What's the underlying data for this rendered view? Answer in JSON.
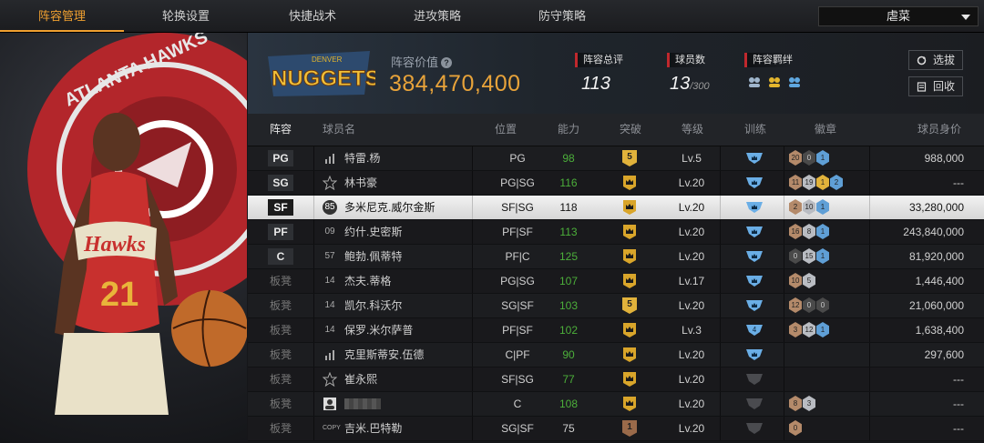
{
  "tabs": [
    {
      "label": "阵容管理",
      "active": true
    },
    {
      "label": "轮换设置",
      "active": false
    },
    {
      "label": "快捷战术",
      "active": false
    },
    {
      "label": "进攻策略",
      "active": false
    },
    {
      "label": "防守策略",
      "active": false
    }
  ],
  "difficulty": {
    "value": "虐菜"
  },
  "left_art": {
    "logo_text": "ATLANTA HAWKS",
    "jersey_text": "Hawks",
    "jersey_number": "21"
  },
  "header": {
    "team_logo_text": "NUGGETS",
    "team_logo_small": "DENVER",
    "value_label": "阵容价值",
    "value": "384,470,400",
    "rating_label": "阵容总评",
    "rating": "113",
    "players_label": "球员数",
    "players": "13",
    "players_max": "/300",
    "bond_label": "阵容羁绊",
    "select_btn": "选拔",
    "recycle_btn": "回收"
  },
  "columns": [
    "阵容",
    "球员名",
    "位置",
    "能力",
    "突破",
    "等级",
    "训练",
    "徽章",
    "球员身价"
  ],
  "colors": {
    "accent": "#f0a030",
    "value": "#e8a33a",
    "green": "#4caf3a",
    "red": "#c0282d"
  },
  "rows": [
    {
      "slot": "PG",
      "starter": true,
      "icon": "bars",
      "name": "特雷.杨",
      "pos": "PG",
      "ovr": "98",
      "green": true,
      "breakthrough": "5",
      "bk_type": "gold-num",
      "level": "Lv.5",
      "train": "blue",
      "badges": [
        [
          "br",
          "20"
        ],
        [
          "dk",
          "0"
        ],
        [
          "bl",
          "1"
        ]
      ],
      "price": "988,000",
      "selected": false
    },
    {
      "slot": "SG",
      "starter": true,
      "icon": "star",
      "name": "林书豪",
      "pos": "PG|SG",
      "ovr": "116",
      "green": true,
      "breakthrough": "",
      "bk_type": "crown",
      "level": "Lv.20",
      "train": "blue",
      "badges": [
        [
          "br",
          "11"
        ],
        [
          "sv",
          "19"
        ],
        [
          "gd",
          "1"
        ],
        [
          "bl",
          "2"
        ]
      ],
      "price": "---",
      "selected": false
    },
    {
      "slot": "SF",
      "starter": true,
      "icon": "85",
      "name": "多米尼克.威尔金斯",
      "pos": "SF|SG",
      "ovr": "118",
      "green": false,
      "breakthrough": "",
      "bk_type": "crown",
      "level": "Lv.20",
      "train": "blue",
      "badges": [
        [
          "br",
          "2"
        ],
        [
          "sv",
          "10"
        ],
        [
          "bl",
          "1"
        ]
      ],
      "price": "33,280,000",
      "selected": true
    },
    {
      "slot": "PF",
      "starter": true,
      "icon": "09",
      "name": "约什.史密斯",
      "pos": "PF|SF",
      "ovr": "113",
      "green": true,
      "breakthrough": "",
      "bk_type": "crown",
      "level": "Lv.20",
      "train": "blue",
      "badges": [
        [
          "br",
          "16"
        ],
        [
          "sv",
          "8"
        ],
        [
          "bl",
          "1"
        ]
      ],
      "price": "243,840,000",
      "selected": false
    },
    {
      "slot": "C",
      "starter": true,
      "icon": "57",
      "name": "鲍勃.佩蒂特",
      "pos": "PF|C",
      "ovr": "125",
      "green": true,
      "breakthrough": "",
      "bk_type": "crown",
      "level": "Lv.20",
      "train": "blue",
      "badges": [
        [
          "dk",
          "0"
        ],
        [
          "sv",
          "15"
        ],
        [
          "bl",
          "1"
        ]
      ],
      "price": "81,920,000",
      "selected": false
    },
    {
      "slot": "板凳",
      "starter": false,
      "icon": "14",
      "name": "杰夫.蒂格",
      "pos": "PG|SG",
      "ovr": "107",
      "green": true,
      "breakthrough": "",
      "bk_type": "crown",
      "level": "Lv.17",
      "train": "blue",
      "badges": [
        [
          "br",
          "10"
        ],
        [
          "sv",
          "5"
        ]
      ],
      "price": "1,446,400",
      "selected": false
    },
    {
      "slot": "板凳",
      "starter": false,
      "icon": "14",
      "name": "凯尔.科沃尔",
      "pos": "SG|SF",
      "ovr": "103",
      "green": true,
      "breakthrough": "5",
      "bk_type": "gold-num",
      "level": "Lv.20",
      "train": "blue",
      "badges": [
        [
          "br",
          "12"
        ],
        [
          "dk",
          "0"
        ],
        [
          "dk",
          "0"
        ]
      ],
      "price": "21,060,000",
      "selected": false
    },
    {
      "slot": "板凳",
      "starter": false,
      "icon": "14",
      "name": "保罗.米尔萨普",
      "pos": "PF|SF",
      "ovr": "102",
      "green": true,
      "breakthrough": "",
      "bk_type": "crown",
      "level": "Lv.3",
      "train": "blue4",
      "badges": [
        [
          "br",
          "3"
        ],
        [
          "sv",
          "12"
        ],
        [
          "bl",
          "1"
        ]
      ],
      "price": "1,638,400",
      "selected": false
    },
    {
      "slot": "板凳",
      "starter": false,
      "icon": "bars",
      "name": "克里斯蒂安.伍德",
      "pos": "C|PF",
      "ovr": "90",
      "green": true,
      "breakthrough": "",
      "bk_type": "crown",
      "level": "Lv.20",
      "train": "blue",
      "badges": [],
      "price": "297,600",
      "selected": false
    },
    {
      "slot": "板凳",
      "starter": false,
      "icon": "star",
      "name": "崔永熙",
      "pos": "SF|SG",
      "ovr": "77",
      "green": true,
      "breakthrough": "",
      "bk_type": "crown",
      "level": "Lv.20",
      "train": "grey",
      "badges": [],
      "price": "---",
      "selected": false
    },
    {
      "slot": "板凳",
      "starter": false,
      "icon": "person",
      "name": "",
      "pos": "C",
      "ovr": "108",
      "green": true,
      "breakthrough": "",
      "bk_type": "crown",
      "level": "Lv.20",
      "train": "grey",
      "badges": [
        [
          "br",
          "8"
        ],
        [
          "sv",
          "3"
        ]
      ],
      "price": "---",
      "selected": false
    },
    {
      "slot": "板凳",
      "starter": false,
      "icon": "COPY",
      "name": "吉米.巴特勒",
      "pos": "SG|SF",
      "ovr": "75",
      "green": false,
      "breakthrough": "1",
      "bk_type": "bronze-num",
      "level": "Lv.20",
      "train": "grey",
      "badges": [
        [
          "br",
          "0"
        ]
      ],
      "price": "---",
      "selected": false
    }
  ]
}
